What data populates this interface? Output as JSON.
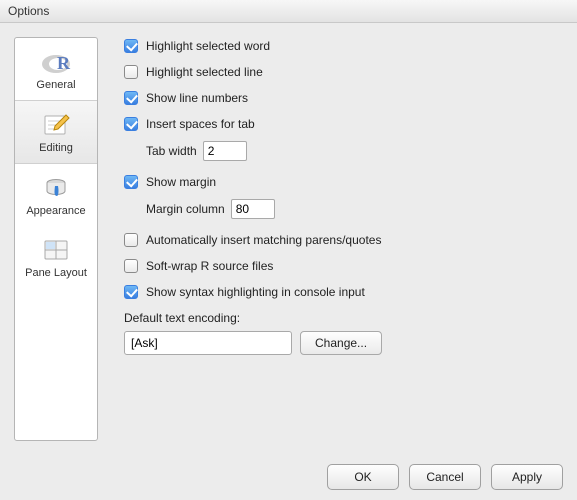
{
  "title": "Options",
  "sidebar": [
    {
      "label": "General"
    },
    {
      "label": "Editing"
    },
    {
      "label": "Appearance"
    },
    {
      "label": "Pane Layout"
    }
  ],
  "options": {
    "highlight_selected_word": "Highlight selected word",
    "highlight_selected_line": "Highlight selected line",
    "show_line_numbers": "Show line numbers",
    "insert_spaces_for_tab": "Insert spaces for tab",
    "tab_width_label": "Tab width",
    "tab_width_value": "2",
    "show_margin": "Show margin",
    "margin_column_label": "Margin column",
    "margin_column_value": "80",
    "auto_match": "Automatically insert matching parens/quotes",
    "soft_wrap": "Soft-wrap R source files",
    "console_syntax": "Show syntax highlighting in console input"
  },
  "encoding": {
    "label": "Default text encoding:",
    "value": "[Ask]",
    "change_btn": "Change..."
  },
  "footer": {
    "ok": "OK",
    "cancel": "Cancel",
    "apply": "Apply"
  }
}
